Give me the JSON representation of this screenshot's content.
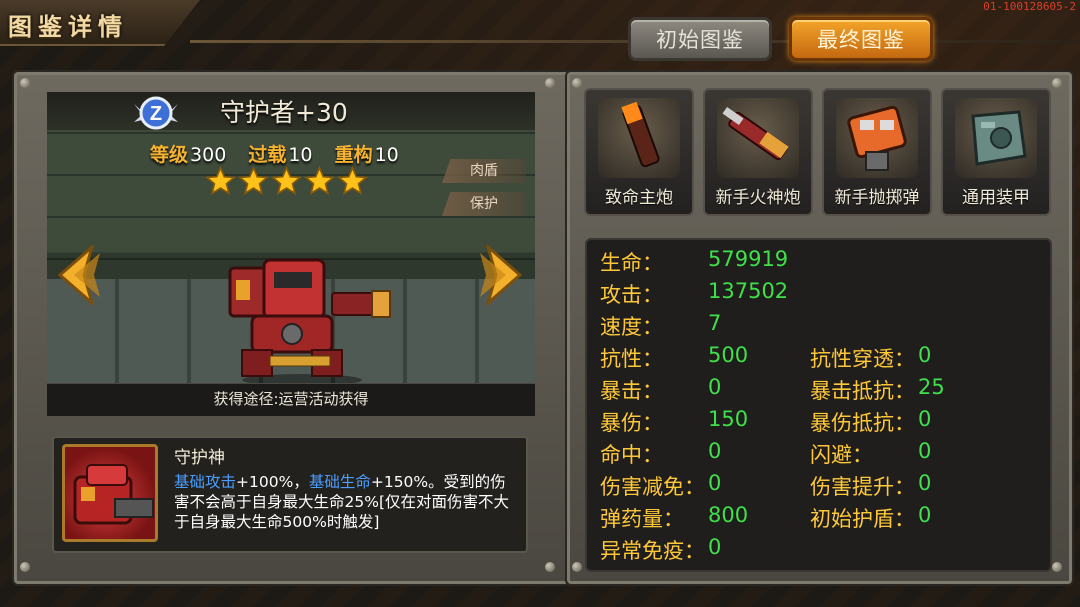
{
  "header": {
    "title": "图鉴详情",
    "server_id": "01-100128605-2",
    "tabs": [
      {
        "label": "初始图鉴",
        "active": false
      },
      {
        "label": "最终图鉴",
        "active": true
      }
    ]
  },
  "hero": {
    "rank_badge": "Z",
    "name": "守护者+30",
    "level_label": "等级",
    "level_value": "300",
    "overload_label": "过载",
    "overload_value": "10",
    "rebuild_label": "重构",
    "rebuild_value": "10",
    "stars": 5,
    "tags": [
      "肉盾",
      "保护"
    ],
    "source": "获得途径:运营活动获得"
  },
  "skill": {
    "name": "守护神",
    "desc_hl1": "基础攻击",
    "desc_t1": "+100%，",
    "desc_hl2": "基础生命",
    "desc_t2": "+150%。受到的伤害不会高于自身最大生命25%[仅在对面伤害不大于自身最大生命500%时触发]"
  },
  "equipment": [
    {
      "label": "致命主炮",
      "icon": "cannon-icon"
    },
    {
      "label": "新手火神炮",
      "icon": "vulcan-gun-icon"
    },
    {
      "label": "新手抛掷弹",
      "icon": "grenade-launcher-icon"
    },
    {
      "label": "通用装甲",
      "icon": "armor-icon"
    }
  ],
  "attributes_left": [
    {
      "k": "生命：",
      "v": "579919"
    },
    {
      "k": "攻击：",
      "v": "137502"
    },
    {
      "k": "速度：",
      "v": "7"
    },
    {
      "k": "抗性：",
      "v": "500"
    },
    {
      "k": "暴击：",
      "v": "0"
    },
    {
      "k": "暴伤：",
      "v": "150"
    },
    {
      "k": "命中：",
      "v": "0"
    },
    {
      "k": "伤害减免：",
      "v": "0"
    },
    {
      "k": "弹药量：",
      "v": "800"
    },
    {
      "k": "异常免疫：",
      "v": "0"
    }
  ],
  "attributes_right": [
    {
      "k": "抗性穿透：",
      "v": "0"
    },
    {
      "k": "暴击抵抗：",
      "v": "25"
    },
    {
      "k": "暴伤抵抗：",
      "v": "0"
    },
    {
      "k": "闪避：",
      "v": "0"
    },
    {
      "k": "伤害提升：",
      "v": "0"
    },
    {
      "k": "初始护盾：",
      "v": "0"
    }
  ],
  "colors": {
    "attr_key": "#ffc83a",
    "attr_value": "#3fe04a",
    "skill_highlight": "#4a9eff",
    "active_tab": "#e8901e"
  }
}
